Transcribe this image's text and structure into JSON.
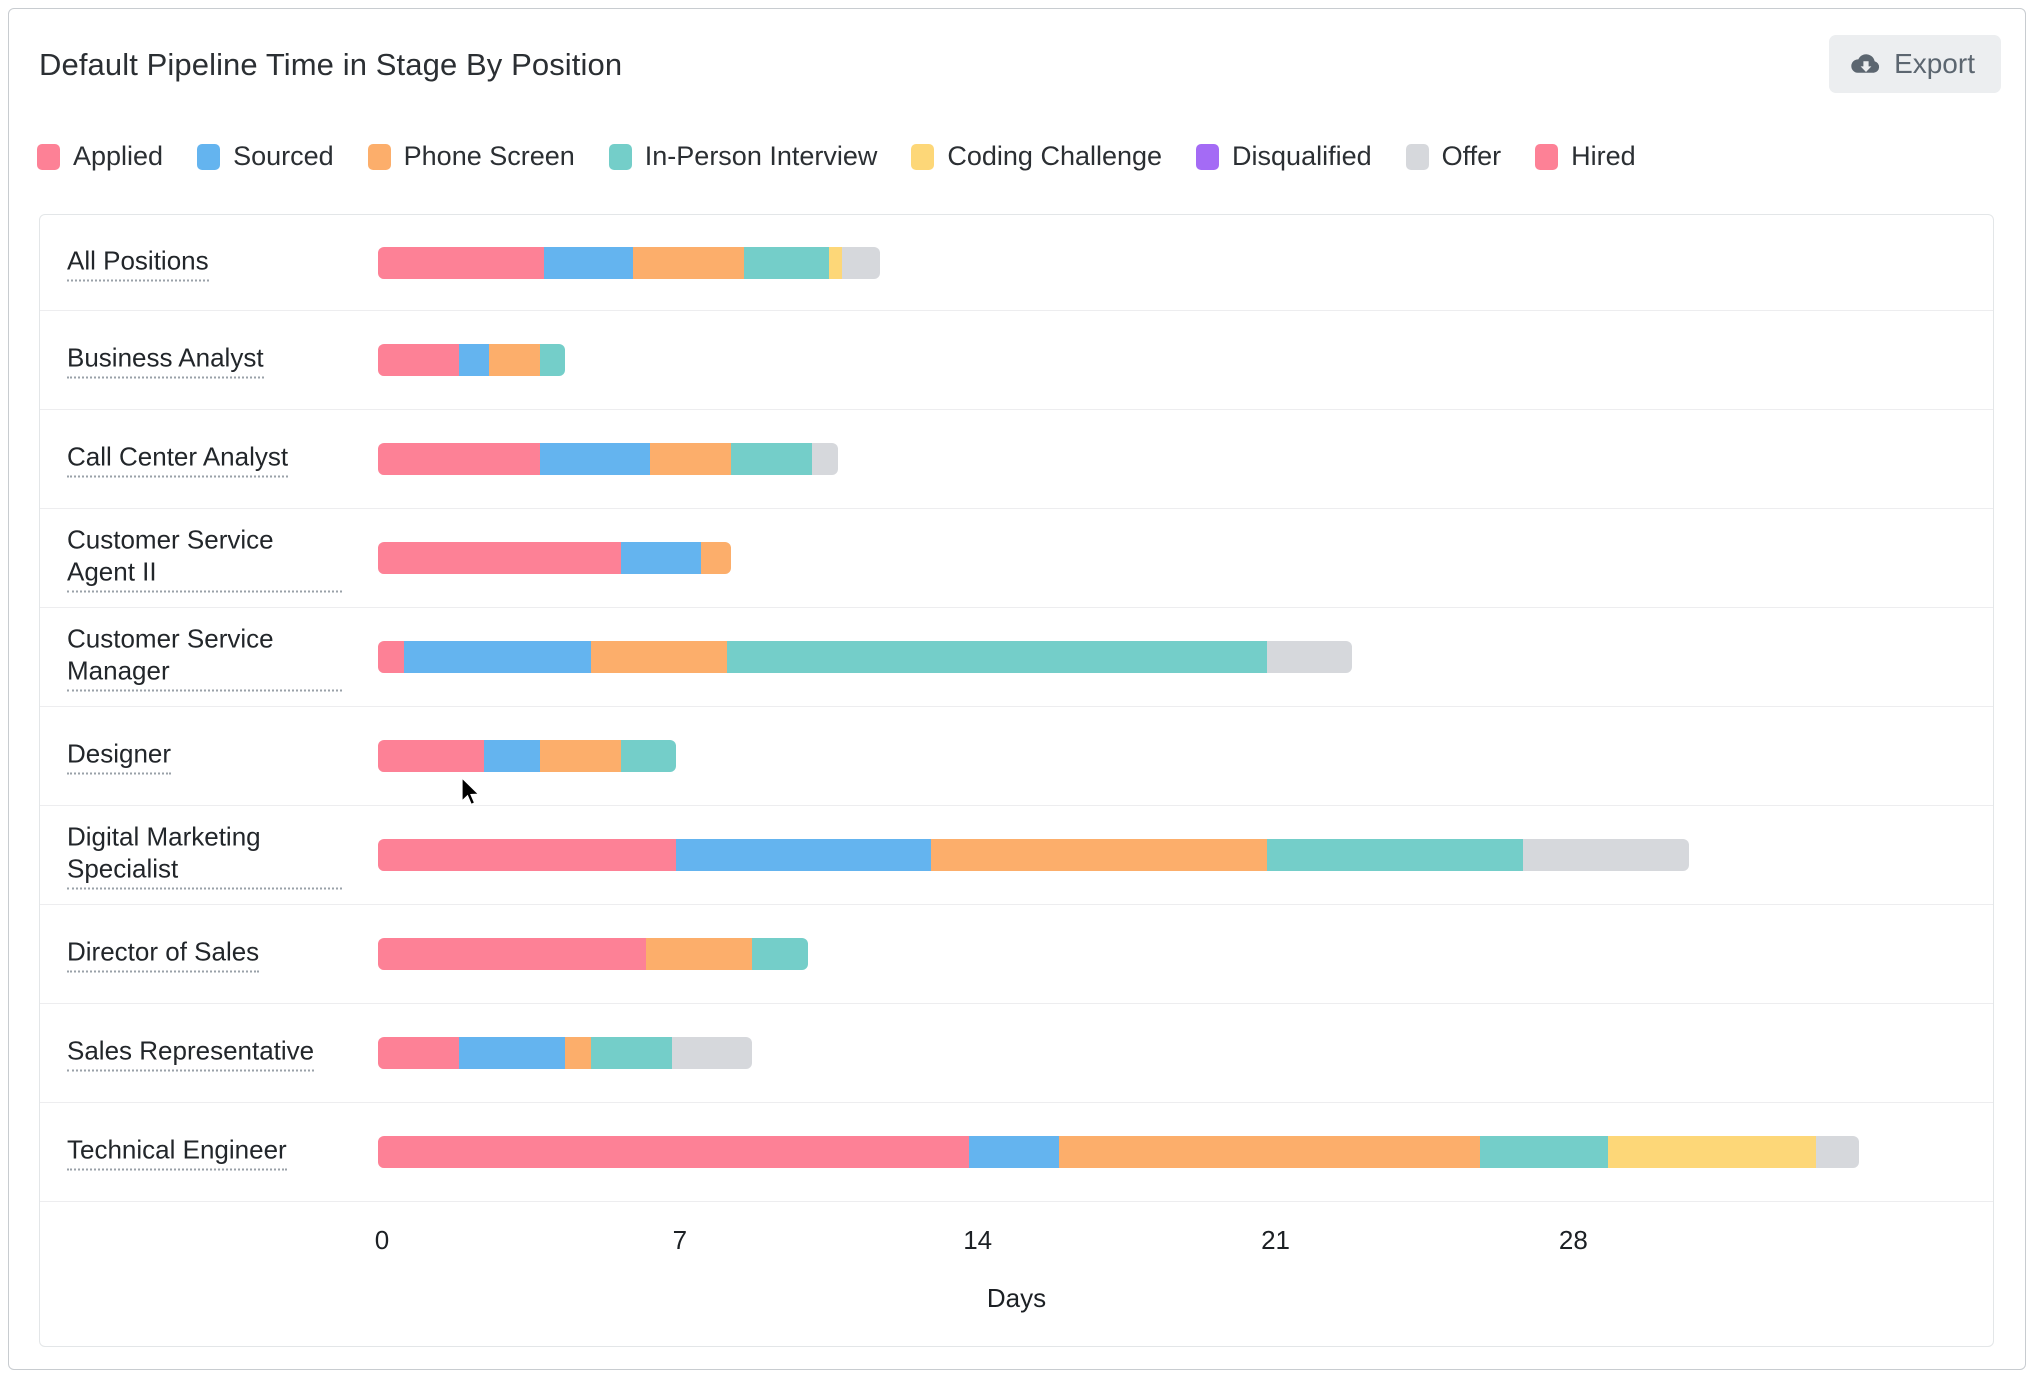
{
  "header": {
    "title": "Default Pipeline Time in Stage By Position",
    "export_label": "Export",
    "export_icon": "cloud-download-icon"
  },
  "chart_data": {
    "type": "bar",
    "orientation": "horizontal",
    "stacked": true,
    "title": "Default Pipeline Time in Stage By Position",
    "xlabel": "Days",
    "ylabel": "",
    "xlim": [
      0,
      36.7
    ],
    "xticks": [
      0,
      7,
      14,
      21,
      28
    ],
    "grid": false,
    "legend_position": "top",
    "legend": [
      {
        "label": "Applied",
        "color": "#fd8196"
      },
      {
        "label": "Sourced",
        "color": "#64b4ef"
      },
      {
        "label": "Phone Screen",
        "color": "#fcae6b"
      },
      {
        "label": "In-Person Interview",
        "color": "#74cec9"
      },
      {
        "label": "Coding Challenge",
        "color": "#fdd778"
      },
      {
        "label": "Disqualified",
        "color": "#a46bf5"
      },
      {
        "label": "Offer",
        "color": "#d6d8dc"
      },
      {
        "label": "Hired",
        "color": "#fd8196"
      }
    ],
    "categories": [
      "All Positions",
      "Business Analyst",
      "Call Center Analyst",
      "Customer Service Agent II",
      "Customer Service Manager",
      "Designer",
      "Digital Marketing Specialist",
      "Director of Sales",
      "Sales Representative",
      "Technical Engineer"
    ],
    "series": [
      {
        "name": "Applied",
        "color": "#fd8196",
        "values": [
          3.9,
          1.9,
          3.8,
          5.7,
          0.6,
          2.5,
          7.0,
          6.3,
          1.9,
          13.9
        ]
      },
      {
        "name": "Sourced",
        "color": "#64b4ef",
        "values": [
          2.1,
          0.7,
          2.6,
          1.9,
          4.4,
          1.3,
          6.0,
          0.0,
          2.5,
          2.1
        ]
      },
      {
        "name": "Phone Screen",
        "color": "#fcae6b",
        "values": [
          2.6,
          1.2,
          1.9,
          0.7,
          3.2,
          1.9,
          7.9,
          2.5,
          0.6,
          9.9
        ]
      },
      {
        "name": "In-Person Interview",
        "color": "#74cec9",
        "values": [
          2.0,
          0.6,
          1.9,
          0.0,
          12.7,
          1.3,
          6.0,
          1.3,
          1.9,
          3.0
        ]
      },
      {
        "name": "Coding Challenge",
        "color": "#fdd778",
        "values": [
          0.3,
          0.0,
          0.0,
          0.0,
          0.0,
          0.0,
          0.0,
          0.0,
          0.0,
          4.9
        ]
      },
      {
        "name": "Disqualified",
        "color": "#a46bf5",
        "values": [
          0.0,
          0.0,
          0.0,
          0.0,
          0.0,
          0.0,
          0.0,
          0.0,
          0.0,
          0.0
        ]
      },
      {
        "name": "Offer",
        "color": "#d6d8dc",
        "values": [
          0.9,
          0.0,
          0.6,
          0.0,
          2.0,
          0.0,
          3.9,
          0.0,
          1.9,
          1.0
        ]
      },
      {
        "name": "Hired",
        "color": "#fd8196",
        "values": [
          0.0,
          0.0,
          0.0,
          0.0,
          0.0,
          0.0,
          0.0,
          0.0,
          0.0,
          0.0
        ]
      }
    ]
  }
}
